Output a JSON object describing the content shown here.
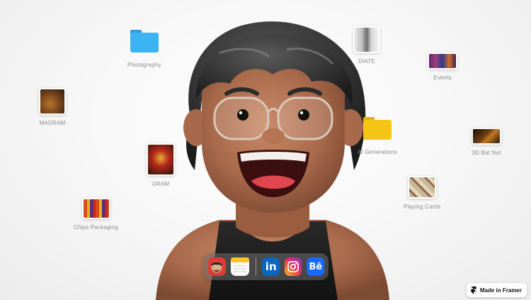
{
  "desktop_items": [
    {
      "id": "photography",
      "label": "Photography",
      "kind": "folder",
      "color": "#3db4f2"
    },
    {
      "id": "diate",
      "label": "DIATE",
      "kind": "image"
    },
    {
      "id": "events",
      "label": "Events",
      "kind": "image"
    },
    {
      "id": "madram",
      "label": "MADRAM",
      "kind": "image"
    },
    {
      "id": "ai-generations",
      "label": "AI Generations",
      "kind": "folder",
      "color": "#f4c514"
    },
    {
      "id": "3d-bat-nut",
      "label": "3D Bat Nut",
      "kind": "image"
    },
    {
      "id": "oram",
      "label": "ORAM",
      "kind": "image"
    },
    {
      "id": "playing-cards",
      "label": "Playing Cards",
      "kind": "image"
    },
    {
      "id": "chips-packaging",
      "label": "Chips Packaging",
      "kind": "image"
    }
  ],
  "dock": {
    "items": [
      {
        "id": "memoji-app",
        "icon": "memoji-icon"
      },
      {
        "id": "notes-app",
        "icon": "notes-icon"
      },
      {
        "id": "linkedin",
        "icon": "linkedin-icon",
        "text": "in",
        "color": "#0a66c2"
      },
      {
        "id": "instagram",
        "icon": "instagram-icon"
      },
      {
        "id": "behance",
        "icon": "behance-icon",
        "text": "Bē",
        "color": "#1769ff"
      }
    ]
  },
  "badge": {
    "label": "Made in Framer"
  }
}
